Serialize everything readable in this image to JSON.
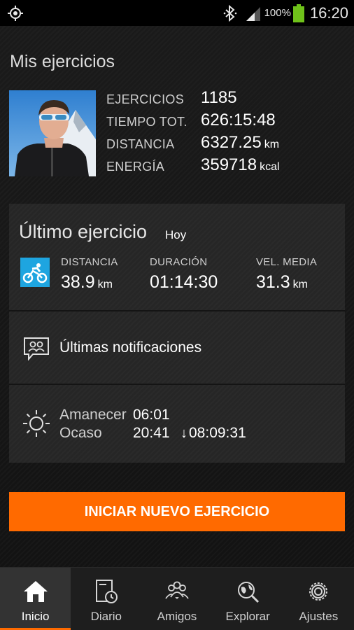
{
  "status_bar": {
    "battery_percent": "100%",
    "time": "16:20",
    "icons": [
      "location-target-icon",
      "bluetooth-icon",
      "signal-icon",
      "battery-icon"
    ]
  },
  "page_title": "Mis ejercicios",
  "profile": {
    "stats": [
      {
        "label": "EJERCICIOS",
        "value": "1185",
        "unit": ""
      },
      {
        "label": "TIEMPO TOT.",
        "value": "626:15:48",
        "unit": ""
      },
      {
        "label": "DISTANCIA",
        "value": "6327.25",
        "unit": "km"
      },
      {
        "label": "ENERGÍA",
        "value": "359718",
        "unit": "kcal"
      }
    ]
  },
  "last_workout": {
    "title": "Último ejercicio",
    "when": "Hoy",
    "sport_icon": "cycling-icon",
    "accent_color": "#1ea5e0",
    "metrics": [
      {
        "label": "DISTANCIA",
        "value": "38.9",
        "unit": "km"
      },
      {
        "label": "DURACIÓN",
        "value": "01:14:30",
        "unit": ""
      },
      {
        "label": "VEL. MEDIA",
        "value": "31.3",
        "unit": "km"
      }
    ]
  },
  "notifications": {
    "label": "Últimas notificaciones",
    "icon": "notifications-icon"
  },
  "sun": {
    "icon": "sun-icon",
    "sunrise_label": "Amanecer",
    "sunrise_time": "06:01",
    "sunset_label": "Ocaso",
    "sunset_time": "20:41",
    "day_length": "08:09:31"
  },
  "start_button": {
    "label": "INICIAR NUEVO EJERCICIO",
    "color": "#ff6a00"
  },
  "nav": {
    "items": [
      {
        "label": "Inicio",
        "icon": "home-icon",
        "active": true
      },
      {
        "label": "Diario",
        "icon": "diary-icon",
        "active": false
      },
      {
        "label": "Amigos",
        "icon": "friends-icon",
        "active": false
      },
      {
        "label": "Explorar",
        "icon": "explore-icon",
        "active": false
      },
      {
        "label": "Ajustes",
        "icon": "settings-icon",
        "active": false
      }
    ]
  }
}
